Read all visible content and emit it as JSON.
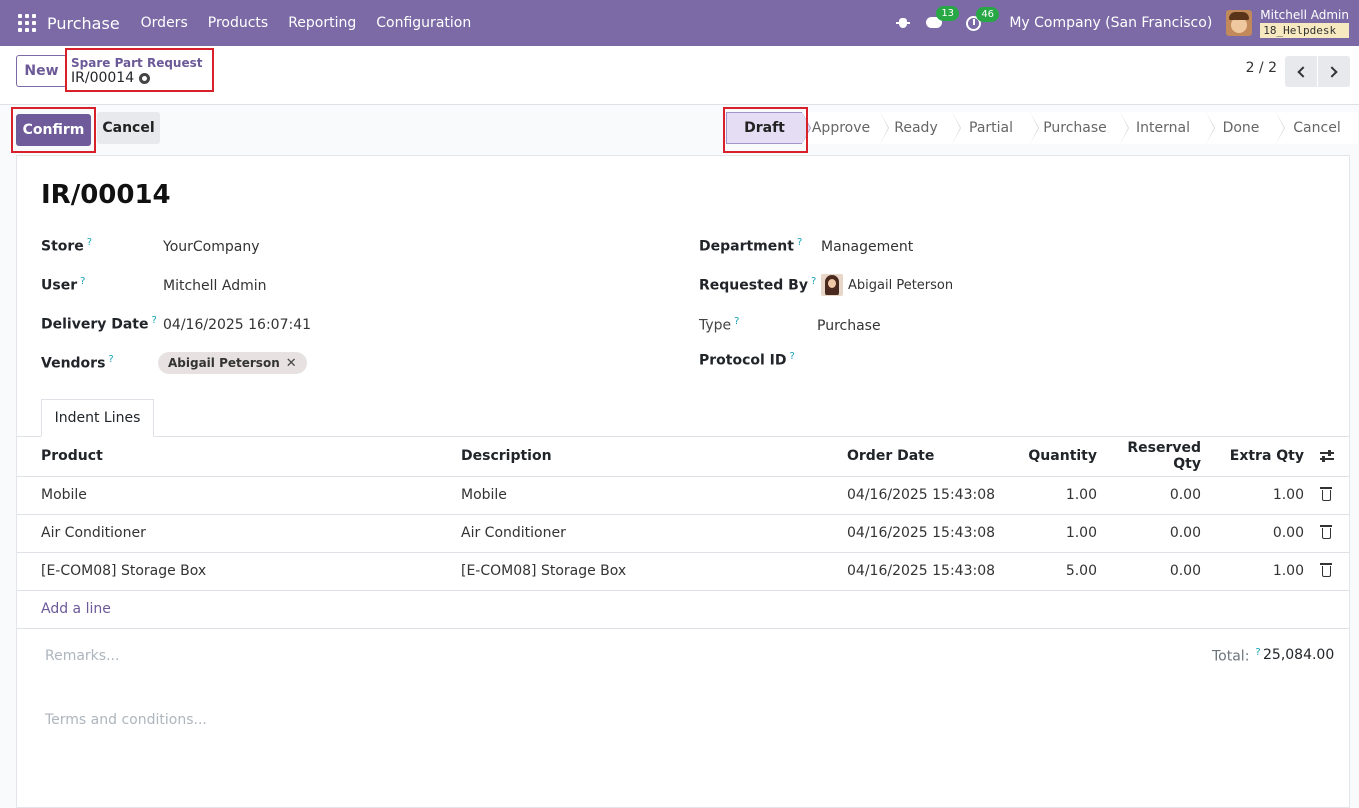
{
  "navbar": {
    "app_name": "Purchase",
    "menus": [
      "Orders",
      "Products",
      "Reporting",
      "Configuration"
    ],
    "chat_count": "13",
    "activity_count": "46",
    "company": "My Company (San Francisco)",
    "user_name": "Mitchell Admin",
    "database": "18_Helpdesk",
    "colors": {
      "bar": "#7b6aa6",
      "badge": "#28a745"
    }
  },
  "control": {
    "new_label": "New",
    "breadcrumb_parent": "Spare Part Request",
    "breadcrumb_current": "IR/00014",
    "pager": "2 / 2"
  },
  "statusbar": {
    "confirm_label": "Confirm",
    "cancel_label": "Cancel",
    "stages": [
      "Draft",
      "Approve",
      "Ready",
      "Partial",
      "Purchase",
      "Internal",
      "Done",
      "Cancel"
    ],
    "active_stage": "Draft"
  },
  "form": {
    "title": "IR/00014",
    "store_label": "Store",
    "store_value": "YourCompany",
    "user_label": "User",
    "user_value": "Mitchell Admin",
    "delivery_label": "Delivery Date",
    "delivery_value": "04/16/2025 16:07:41",
    "vendors_label": "Vendors",
    "vendors_tag": "Abigail Peterson",
    "department_label": "Department",
    "department_value": "Management",
    "requested_label": "Requested By",
    "requested_value": "Abigail Peterson",
    "type_label": "Type",
    "type_value": "Purchase",
    "protocol_label": "Protocol ID",
    "help_mark": "?"
  },
  "tabs": {
    "indent_lines": "Indent Lines"
  },
  "table": {
    "headers": {
      "product": "Product",
      "description": "Description",
      "order_date": "Order Date",
      "quantity": "Quantity",
      "reserved": "Reserved Qty",
      "extra": "Extra Qty"
    },
    "rows": [
      {
        "product": "Mobile",
        "description": "Mobile",
        "order_date": "04/16/2025 15:43:08",
        "quantity": "1.00",
        "reserved": "0.00",
        "extra": "1.00"
      },
      {
        "product": "Air Conditioner",
        "description": "Air Conditioner",
        "order_date": "04/16/2025 15:43:08",
        "quantity": "1.00",
        "reserved": "0.00",
        "extra": "0.00"
      },
      {
        "product": "[E-COM08] Storage Box",
        "description": "[E-COM08] Storage Box",
        "order_date": "04/16/2025 15:43:08",
        "quantity": "5.00",
        "reserved": "0.00",
        "extra": "1.00"
      }
    ],
    "add_line": "Add a line"
  },
  "footer": {
    "remarks_placeholder": "Remarks...",
    "terms_placeholder": "Terms and conditions...",
    "total_label": "Total:",
    "total_value": "25,084.00"
  }
}
